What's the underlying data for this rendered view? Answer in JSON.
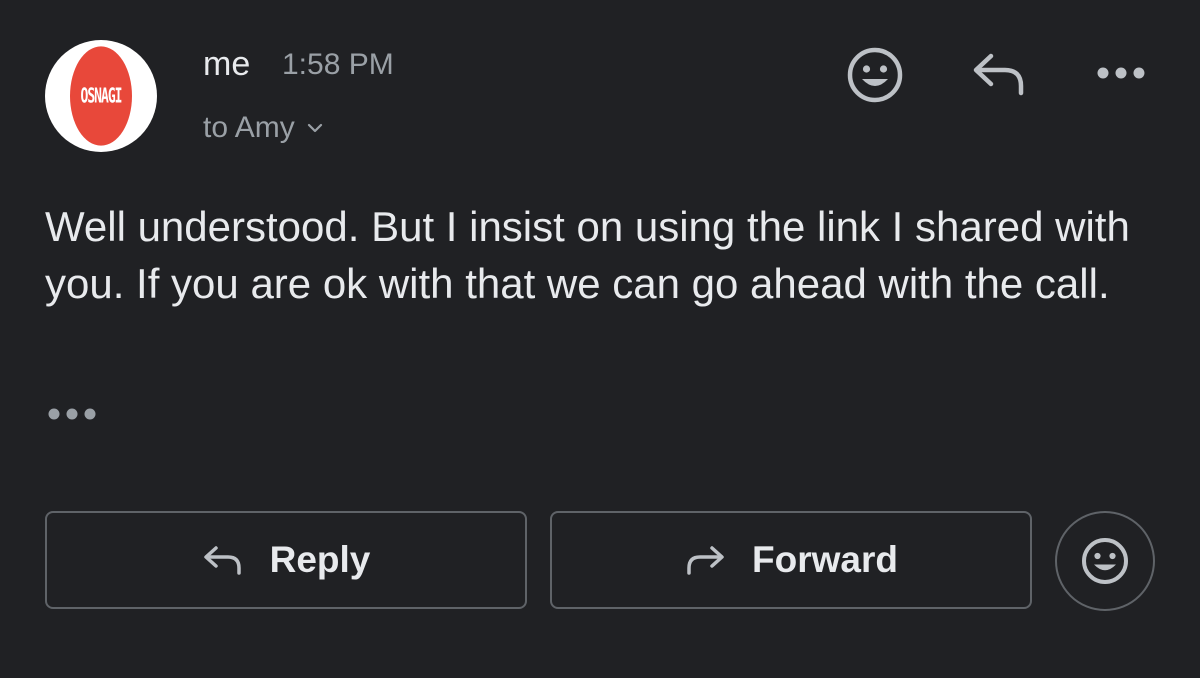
{
  "sender": {
    "name": "me",
    "time": "1:58 PM",
    "avatar_text": "OSNAGI"
  },
  "recipient": {
    "label": "to Amy"
  },
  "message": {
    "body": "Well understood. But I insist on using the link I shared with you. If you are ok with that we can go ahead with the call."
  },
  "header_actions": {
    "icons": [
      "add-emoji-reaction-icon",
      "reply-icon",
      "more-options-icon"
    ]
  },
  "footer_actions": {
    "reply_label": "Reply",
    "forward_label": "Forward",
    "emoji_icon": "add-emoji-reaction-icon"
  },
  "colors": {
    "background": "#202124",
    "primary_text": "#e8eaed",
    "secondary_text": "#9aa0a6",
    "border": "#5f6368",
    "avatar_accent": "#e8483a"
  }
}
